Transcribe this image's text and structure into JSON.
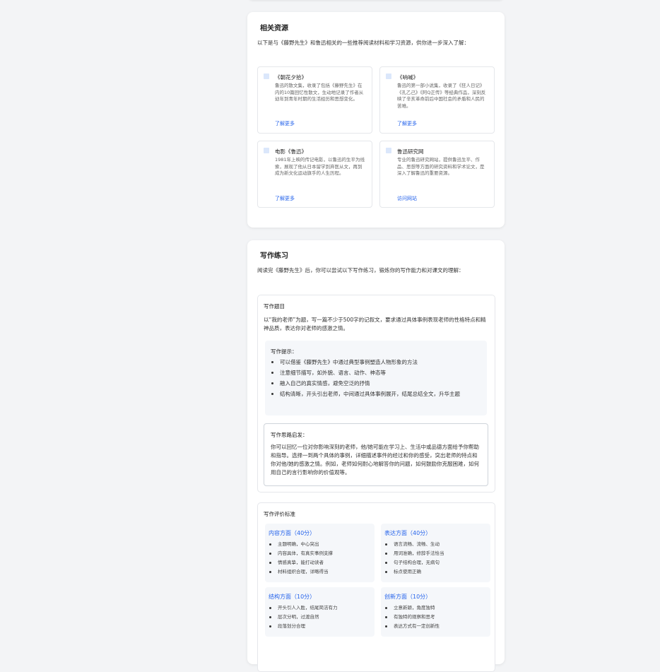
{
  "resources": {
    "title": "相关资源",
    "intro": "以下是与《藤野先生》和鲁迅相关的一些推荐阅读材料和学习资源，供你进一步深入了解：",
    "items": [
      {
        "title": "《朝花夕拾》",
        "desc": "鲁迅的散文集，收录了包括《藤野先生》在内的10篇回忆性散文，生动地记录了作者从幼年到青年时期的生活经历和思想变化。",
        "link": "了解更多"
      },
      {
        "title": "《呐喊》",
        "desc": "鲁迅的第一部小说集，收录了《狂人日记》《孔乙己》《阿Q正传》等经典作品，深刻反映了辛亥革命前后中国社会的矛盾和人民的苦难。",
        "link": "了解更多"
      },
      {
        "title": "电影《鲁迅》",
        "desc": "1981年上映的传记电影，以鲁迅的生平为线索，展现了他从日本留学到弃医从文，再到成为新文化运动旗手的人生历程。",
        "link": "了解更多"
      },
      {
        "title": "鲁迅研究网",
        "desc": "专业的鲁迅研究网站，提供鲁迅生平、作品、思想等方面的研究资料和学术论文，是深入了解鲁迅的重要资源。",
        "link": "访问网站"
      }
    ]
  },
  "writing": {
    "title": "写作练习",
    "intro": "阅读完《藤野先生》后，你可以尝试以下写作练习，锻炼你的写作能力和对课文的理解：",
    "topic_label": "写作题目",
    "topic_text": "以“我的老师”为题，写一篇不少于500字的记叙文，要求通过具体事例表现老师的性格特点和精神品质，表达你对老师的感激之情。",
    "tips_label": "写作提示：",
    "tips": [
      "可以借鉴《藤野先生》中通过典型事例塑造人物形象的方法",
      "注意细节描写，如外貌、语言、动作、神态等",
      "融入自己的真实情感，避免空泛的抒情",
      "结构清晰，开头引出老师，中间通过具体事例展开，结尾总结全文，升华主题"
    ],
    "idea_label": "写作思路启发：",
    "idea_text": "你可以回忆一位对你影响深刻的老师，他/她可能在学习上、生活中或品德方面给予你帮助和指导。选择一到两个具体的事例，详细描述事件的经过和你的感受，突出老师的特点和你对他/她的感激之情。例如，老师如何耐心地解答你的问题，如何鼓励你克服困难，如何用自己的言行影响你的价值观等。",
    "criteria_label": "写作评价标准",
    "criteria": [
      {
        "title": "内容方面（40分）",
        "items": [
          "主题明确，中心突出",
          "内容具体，有真实事例支撑",
          "情感真挚，能打动读者",
          "材料组织合理，详略得当"
        ]
      },
      {
        "title": "表达方面（40分）",
        "items": [
          "语言流畅、流畅、生动",
          "用词准确，修辞手法恰当",
          "句子结构合理，无病句",
          "标点使用正确"
        ]
      },
      {
        "title": "结构方面（10分）",
        "items": [
          "开头引人入胜，结尾简洁有力",
          "层次分明，过渡自然",
          "段落划分合理"
        ]
      },
      {
        "title": "创新方面（10分）",
        "items": [
          "立意新颖，角度独特",
          "有独特的观察和思考",
          "表达方式有一定创新性"
        ]
      }
    ]
  }
}
